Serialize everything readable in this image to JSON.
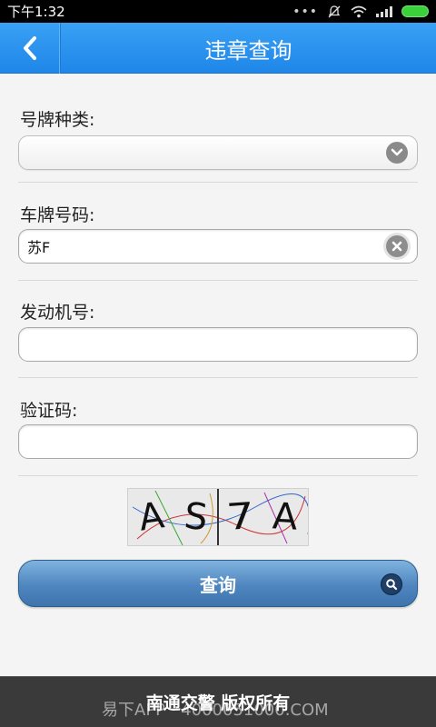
{
  "status_bar": {
    "time": "下午1:32",
    "icons": [
      "overflow-dots-icon",
      "mute-notification-icon",
      "wifi-icon",
      "signal-icon",
      "battery-icon"
    ]
  },
  "header": {
    "title": "违章查询",
    "back_icon": "chevron-left-icon",
    "background": "#2a92ef"
  },
  "form": {
    "plate_type": {
      "label": "号牌种类:",
      "value": "",
      "icon": "chevron-down-icon"
    },
    "plate_number": {
      "label": "车牌号码:",
      "value": "苏F",
      "icon": "clear-icon"
    },
    "engine_number": {
      "label": "发动机号:",
      "value": ""
    },
    "verify_code": {
      "label": "验证码:",
      "value": ""
    },
    "captcha": {
      "chars": [
        "A",
        "S",
        "7",
        "A"
      ]
    },
    "submit": {
      "label": "查询",
      "icon": "search-icon",
      "color": "#4f86bf"
    }
  },
  "footer": {
    "copyright": "南通交警 版权所有",
    "watermark": "易下APP · 4000051000.COM"
  }
}
